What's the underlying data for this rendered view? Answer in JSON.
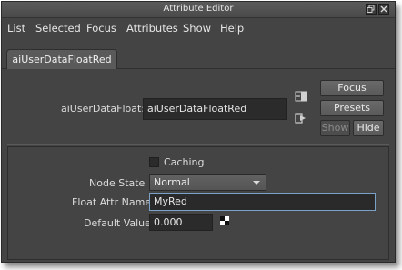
{
  "window": {
    "title": "Attribute Editor"
  },
  "menu": [
    "List",
    "Selected",
    "Focus",
    "Attributes",
    "Show",
    "Help"
  ],
  "tab": {
    "label": "aiUserDataFloatRed"
  },
  "node": {
    "label": "aiUserDataFloat:",
    "value": "aiUserDataFloatRed"
  },
  "buttons": {
    "focus": "Focus",
    "presets": "Presets",
    "show": "Show",
    "hide": "Hide"
  },
  "attributes": {
    "caching_label": "Caching",
    "caching_checked": false,
    "node_state_label": "Node State",
    "node_state_value": "Normal",
    "float_attr_label": "Float Attr Name",
    "float_attr_value": "MyRed",
    "default_value_label": "Default Value",
    "default_value": "0.000"
  },
  "icons": {
    "titlebar": [
      "restore-icon",
      "close-icon"
    ],
    "node_arrows": [
      "input-connection-icon",
      "output-connection-icon"
    ],
    "map": "checker-map-icon"
  }
}
